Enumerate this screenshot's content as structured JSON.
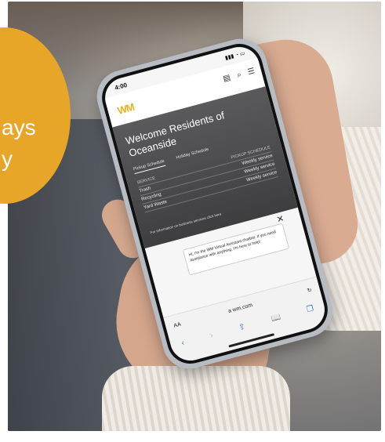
{
  "badge": {
    "line1": "ays",
    "line2": "y"
  },
  "phone": {
    "status_time": "4:00",
    "logo": "WM",
    "hero": {
      "title": "Welcome Residents of Oceanside",
      "tabs": [
        "Pickup Schedule",
        "Holiday Schedule"
      ],
      "schedule_headers": [
        "SERVICE",
        "PICKUP SCHEDULE"
      ],
      "schedule_rows": [
        {
          "service": "Trash",
          "schedule": "Weekly service"
        },
        {
          "service": "Recycling",
          "schedule": "Weekly service"
        },
        {
          "service": "Yard Waste",
          "schedule": "Weekly service"
        }
      ],
      "info": "For information on business services click here"
    },
    "chat": {
      "message": "Hi, I'm the WM Virtual Assistant chatbot. If you need assistance with anything, I'm here to help!",
      "close": "✕"
    },
    "browser": {
      "aa": "AA",
      "url": "a wm.com",
      "icons": {
        "back": "‹",
        "forward": "›",
        "share": "⇪",
        "bookmarks": "📖",
        "tabs": "❐",
        "reload": "↻"
      }
    }
  }
}
